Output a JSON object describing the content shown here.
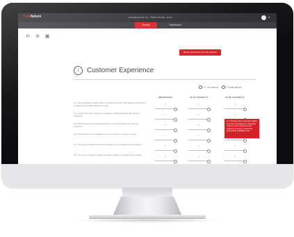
{
  "header": {
    "logo_main": "tres",
    "logo_accent": "future",
    "user_info": "martin@tresfuture.org · TRES FUTURE · admin",
    "avatar_icon": "user-avatar-icon",
    "menu_icon": "chevron-down-icon"
  },
  "tabs": [
    {
      "label": "Survey",
      "active": true
    },
    {
      "label": "Dashboard",
      "active": false
    }
  ],
  "toolbar": {
    "back_icon": "back-arrow-icon",
    "forward_icon": "forward-arrow-icon",
    "save_icon": "save-icon"
  },
  "action_button": "Please respond to all of the answers",
  "section": {
    "icon": "info-icon",
    "title": "Customer Experience"
  },
  "legend": {
    "low": "1 = Low Maturity",
    "high": "5 = High Maturity"
  },
  "columns": [
    "IMPORTANCE",
    "AS IS CAPABILITY",
    "TO BE CAPABILITY"
  ],
  "rows": [
    {
      "question": "Q.1: The organization's digital customer experience tools and sites match the ones offered to visitors through digital channels and sites",
      "values": [
        "3",
        "3",
        "3"
      ]
    },
    {
      "question": "Q.2: A single view of the customer is leveraged in digital interactions with customer experience",
      "values": [
        "3",
        "3",
        "3"
      ]
    },
    {
      "question": "Q.3: Digital touchpoints and digital interactions are used to enhance the customer experience",
      "values": [
        "3",
        "3",
        "3"
      ]
    },
    {
      "question": "Q.4: Physical store tools and digital tools are connected in a seamless manner",
      "values": [
        "3",
        "3",
        "3"
      ]
    },
    {
      "question": "Q.5: The journey in different contexts and digital customer experience can be tailored",
      "values": [
        "3",
        "3",
        "3"
      ]
    },
    {
      "question": "Q.6: The journey in different contexts and digital customer experiences are consistent",
      "values": [
        "3",
        "3",
        "3"
      ]
    }
  ],
  "tooltip": "Q.4: Physical store tools and digital tools are connected in a seamless manner across channels and customer journeys. Select the appropriate capability level.",
  "colors": {
    "brand_red": "#d91f26",
    "topbar": "#2b2b2f"
  }
}
